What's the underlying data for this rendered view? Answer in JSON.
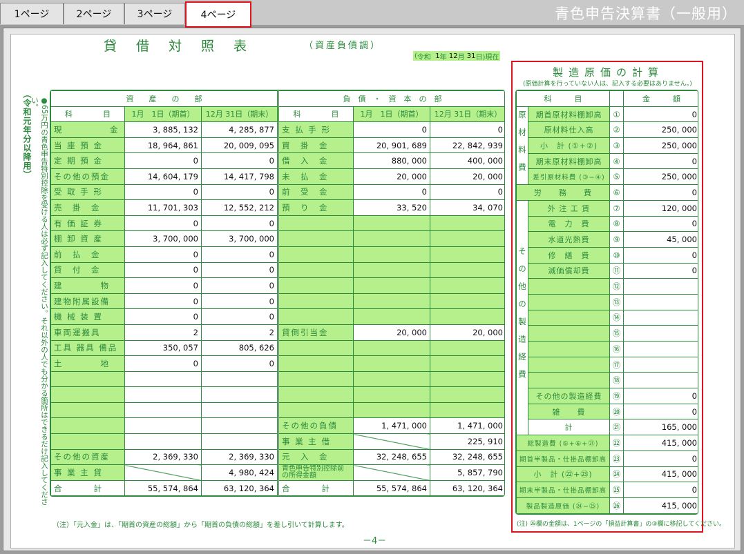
{
  "app_title": "青色申告決算書（一般用）",
  "tabs": [
    {
      "label": "1ページ"
    },
    {
      "label": "2ページ"
    },
    {
      "label": "3ページ"
    },
    {
      "label": "4ページ",
      "active": true
    }
  ],
  "balance_sheet": {
    "title": "貸借対照表",
    "subtitle": "（資産負債調）",
    "as_of": {
      "era": "令和",
      "year": "1",
      "month": "12",
      "day": "31",
      "suffix": "現在"
    },
    "vertical_title": "（令和元年分以降用）",
    "vertical_note": "●65万円の青色申告特別控除を受ける人は必ず記入してください。それ以外の人でも分かる箇所はできるだけ記入してください。",
    "headers": {
      "assets": "資　　産　　の　　部",
      "liabilities": "負　債　・　資　本　の　部",
      "item": "科　　　　目",
      "start": "1月　1日（期首）",
      "end": "12月 31日（期末）"
    },
    "asset_rows": [
      {
        "label": "現　　　　　金",
        "start": "3, 885, 132",
        "end": "4, 285, 877"
      },
      {
        "label": "当 座 預 金",
        "start": "18, 964, 861",
        "end": "20, 009, 095"
      },
      {
        "label": "定 期 預 金",
        "start": "0",
        "end": "0"
      },
      {
        "label": "その他の預金",
        "start": "14, 604, 179",
        "end": "14, 417, 798"
      },
      {
        "label": "受 取 手 形",
        "start": "0",
        "end": "0"
      },
      {
        "label": "売　掛　金",
        "start": "11, 701, 303",
        "end": "12, 552, 212"
      },
      {
        "label": "有 価 証 券",
        "start": "0",
        "end": "0"
      },
      {
        "label": "棚 卸 資 産",
        "start": "3, 700, 000",
        "end": "3, 700, 000"
      },
      {
        "label": "前　払　金",
        "start": "0",
        "end": "0"
      },
      {
        "label": "貸　付　金",
        "start": "0",
        "end": "0"
      },
      {
        "label": "建　　　　物",
        "start": "0",
        "end": "0"
      },
      {
        "label": "建物附属設備",
        "start": "0",
        "end": "0"
      },
      {
        "label": "機 械 装 置",
        "start": "0",
        "end": "0"
      },
      {
        "label": "車両運搬具",
        "start": "2",
        "end": "2"
      },
      {
        "label": "工具 器具 備品",
        "start": "350, 057",
        "end": "805, 626"
      },
      {
        "label": "土　　　　地",
        "start": "0",
        "end": "0"
      },
      {
        "label": "",
        "start": "",
        "end": ""
      },
      {
        "label": "",
        "start": "",
        "end": ""
      },
      {
        "label": "",
        "start": "",
        "end": ""
      },
      {
        "label": "",
        "start": "",
        "end": ""
      },
      {
        "label": "",
        "start": "",
        "end": ""
      },
      {
        "label": "その他の資産",
        "start": "2, 369, 330",
        "end": "2, 369, 330"
      },
      {
        "label": "事 業 主 貸",
        "start": "",
        "end": "4, 980, 424"
      },
      {
        "label": "合　　　　計",
        "start": "55, 574, 864",
        "end": "63, 120, 364"
      }
    ],
    "liability_rows": [
      {
        "label": "支 払 手 形",
        "start": "0",
        "end": "0"
      },
      {
        "label": "買　掛　金",
        "start": "20, 901, 689",
        "end": "22, 842, 939"
      },
      {
        "label": "借　入　金",
        "start": "880, 000",
        "end": "400, 000"
      },
      {
        "label": "未　払　金",
        "start": "20, 000",
        "end": "20, 000"
      },
      {
        "label": "前　受　金",
        "start": "0",
        "end": "0"
      },
      {
        "label": "預　り　金",
        "start": "33, 520",
        "end": "34, 070"
      },
      {
        "label": "",
        "start": "",
        "end": ""
      },
      {
        "label": "",
        "start": "",
        "end": ""
      },
      {
        "label": "",
        "start": "",
        "end": ""
      },
      {
        "label": "",
        "start": "",
        "end": ""
      },
      {
        "label": "",
        "start": "",
        "end": ""
      },
      {
        "label": "",
        "start": "",
        "end": ""
      },
      {
        "label": "",
        "start": "",
        "end": ""
      },
      {
        "label": "貸倒引当金",
        "start": "20, 000",
        "end": "20, 000"
      },
      {
        "label": "",
        "start": "",
        "end": ""
      },
      {
        "label": "",
        "start": "",
        "end": ""
      },
      {
        "label": "",
        "start": "",
        "end": ""
      },
      {
        "label": "",
        "start": "",
        "end": ""
      },
      {
        "label": "",
        "start": "",
        "end": ""
      },
      {
        "label": "その他の負債",
        "start": "1, 471, 000",
        "end": "1, 471, 000"
      },
      {
        "label": "事 業 主 借",
        "start": "",
        "end": "225, 910"
      },
      {
        "label": "元　入　金",
        "start": "32, 248, 655",
        "end": "32, 248, 655"
      },
      {
        "label": "青色申告特別控除前の所得金額",
        "start": "",
        "end": "5, 857, 790"
      },
      {
        "label": "合　　　　計",
        "start": "55, 574, 864",
        "end": "63, 120, 364"
      }
    ],
    "footnote": "（注）「元入金」は、「期首の資産の総額」から「期首の負債の総額」を差し引いて計算します。",
    "page_number": "－4－"
  },
  "manufacturing_cost": {
    "title": "製造原価の計算",
    "subtitle": "(原価計算を行っていない人は、記入する必要はありません。)",
    "headers": {
      "item": "科　　　目",
      "amount": "金　　　額"
    },
    "cat_material": "原材料費",
    "cat_other": "その他の製造経費",
    "rows": [
      {
        "no": "①",
        "label": "期首原材料棚卸高",
        "value": "0"
      },
      {
        "no": "②",
        "label": "原材料仕入高",
        "value": "250, 000"
      },
      {
        "no": "③",
        "label": "小　計 (①+②)",
        "value": "250, 000"
      },
      {
        "no": "④",
        "label": "期末原材料棚卸高",
        "value": "0"
      },
      {
        "no": "⑤",
        "label": "差引原材料費 (③−④)",
        "value": "250, 000"
      },
      {
        "no": "⑥",
        "label": "労　　務　　費",
        "value": "0"
      },
      {
        "no": "⑦",
        "label": "外 注 工 賃",
        "value": "120, 000"
      },
      {
        "no": "⑧",
        "label": "電　力　費",
        "value": "0"
      },
      {
        "no": "⑨",
        "label": "水道光熱費",
        "value": "45, 000"
      },
      {
        "no": "⑩",
        "label": "修　繕　費",
        "value": "0"
      },
      {
        "no": "⑪",
        "label": "減価償却費",
        "value": "0"
      },
      {
        "no": "⑫",
        "label": "",
        "value": ""
      },
      {
        "no": "⑬",
        "label": "",
        "value": ""
      },
      {
        "no": "⑭",
        "label": "",
        "value": ""
      },
      {
        "no": "⑮",
        "label": "",
        "value": ""
      },
      {
        "no": "⑯",
        "label": "",
        "value": ""
      },
      {
        "no": "⑰",
        "label": "",
        "value": ""
      },
      {
        "no": "⑱",
        "label": "",
        "value": ""
      },
      {
        "no": "⑲",
        "label": "その他の製造経費",
        "value": "0"
      },
      {
        "no": "⑳",
        "label": "雑　　費",
        "value": "0"
      },
      {
        "no": "㉑",
        "label": "計",
        "value": "165, 000"
      },
      {
        "no": "㉒",
        "label": "総製造費 (⑤+⑥+㉑)",
        "value": "415, 000"
      },
      {
        "no": "㉓",
        "label": "期首半製品・仕掛品棚卸高",
        "value": "0"
      },
      {
        "no": "㉔",
        "label": "小　計 (㉒+㉓)",
        "value": "415, 000"
      },
      {
        "no": "㉕",
        "label": "期末半製品・仕掛品棚卸高",
        "value": "0"
      },
      {
        "no": "㉖",
        "label": "製品製造原価 (㉔−㉕)",
        "value": "415, 000"
      }
    ],
    "footnote": "(注) ㉖欄の金額は、1ページの「損益計算書」の③欄に移記してください。"
  },
  "colors": {
    "accent_green": "#2c8a3c",
    "fill_green": "#b6f08c",
    "highlight_red": "#e0121e"
  }
}
